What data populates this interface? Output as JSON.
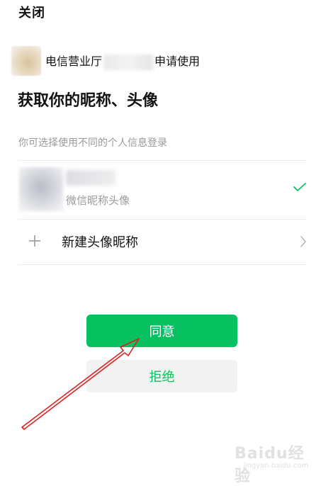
{
  "header": {
    "close_label": "关闭"
  },
  "app": {
    "name_prefix": "电信营业厅",
    "name_suffix": "申请使用"
  },
  "title": "获取你的昵称、头像",
  "subtitle": "你可选择使用不同的个人信息登录",
  "account": {
    "subtitle": "微信昵称头像",
    "selected": true
  },
  "new_profile": {
    "label": "新建头像昵称"
  },
  "buttons": {
    "agree": "同意",
    "reject": "拒绝"
  },
  "watermark": {
    "text": "Baidu经验",
    "url": "jingyan.baidu.com"
  },
  "colors": {
    "accent": "#07c160",
    "annotation_arrow": "#e02020"
  },
  "icons": [
    "check-icon",
    "plus-icon",
    "chevron-right-icon"
  ]
}
